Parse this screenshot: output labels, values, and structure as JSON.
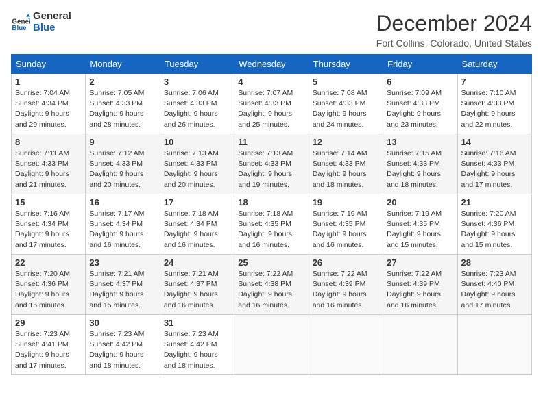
{
  "logo": {
    "line1": "General",
    "line2": "Blue"
  },
  "title": "December 2024",
  "location": "Fort Collins, Colorado, United States",
  "days_of_week": [
    "Sunday",
    "Monday",
    "Tuesday",
    "Wednesday",
    "Thursday",
    "Friday",
    "Saturday"
  ],
  "weeks": [
    [
      {
        "day": "1",
        "sunrise": "Sunrise: 7:04 AM",
        "sunset": "Sunset: 4:34 PM",
        "daylight": "Daylight: 9 hours and 29 minutes."
      },
      {
        "day": "2",
        "sunrise": "Sunrise: 7:05 AM",
        "sunset": "Sunset: 4:33 PM",
        "daylight": "Daylight: 9 hours and 28 minutes."
      },
      {
        "day": "3",
        "sunrise": "Sunrise: 7:06 AM",
        "sunset": "Sunset: 4:33 PM",
        "daylight": "Daylight: 9 hours and 26 minutes."
      },
      {
        "day": "4",
        "sunrise": "Sunrise: 7:07 AM",
        "sunset": "Sunset: 4:33 PM",
        "daylight": "Daylight: 9 hours and 25 minutes."
      },
      {
        "day": "5",
        "sunrise": "Sunrise: 7:08 AM",
        "sunset": "Sunset: 4:33 PM",
        "daylight": "Daylight: 9 hours and 24 minutes."
      },
      {
        "day": "6",
        "sunrise": "Sunrise: 7:09 AM",
        "sunset": "Sunset: 4:33 PM",
        "daylight": "Daylight: 9 hours and 23 minutes."
      },
      {
        "day": "7",
        "sunrise": "Sunrise: 7:10 AM",
        "sunset": "Sunset: 4:33 PM",
        "daylight": "Daylight: 9 hours and 22 minutes."
      }
    ],
    [
      {
        "day": "8",
        "sunrise": "Sunrise: 7:11 AM",
        "sunset": "Sunset: 4:33 PM",
        "daylight": "Daylight: 9 hours and 21 minutes."
      },
      {
        "day": "9",
        "sunrise": "Sunrise: 7:12 AM",
        "sunset": "Sunset: 4:33 PM",
        "daylight": "Daylight: 9 hours and 20 minutes."
      },
      {
        "day": "10",
        "sunrise": "Sunrise: 7:13 AM",
        "sunset": "Sunset: 4:33 PM",
        "daylight": "Daylight: 9 hours and 20 minutes."
      },
      {
        "day": "11",
        "sunrise": "Sunrise: 7:13 AM",
        "sunset": "Sunset: 4:33 PM",
        "daylight": "Daylight: 9 hours and 19 minutes."
      },
      {
        "day": "12",
        "sunrise": "Sunrise: 7:14 AM",
        "sunset": "Sunset: 4:33 PM",
        "daylight": "Daylight: 9 hours and 18 minutes."
      },
      {
        "day": "13",
        "sunrise": "Sunrise: 7:15 AM",
        "sunset": "Sunset: 4:33 PM",
        "daylight": "Daylight: 9 hours and 18 minutes."
      },
      {
        "day": "14",
        "sunrise": "Sunrise: 7:16 AM",
        "sunset": "Sunset: 4:33 PM",
        "daylight": "Daylight: 9 hours and 17 minutes."
      }
    ],
    [
      {
        "day": "15",
        "sunrise": "Sunrise: 7:16 AM",
        "sunset": "Sunset: 4:34 PM",
        "daylight": "Daylight: 9 hours and 17 minutes."
      },
      {
        "day": "16",
        "sunrise": "Sunrise: 7:17 AM",
        "sunset": "Sunset: 4:34 PM",
        "daylight": "Daylight: 9 hours and 16 minutes."
      },
      {
        "day": "17",
        "sunrise": "Sunrise: 7:18 AM",
        "sunset": "Sunset: 4:34 PM",
        "daylight": "Daylight: 9 hours and 16 minutes."
      },
      {
        "day": "18",
        "sunrise": "Sunrise: 7:18 AM",
        "sunset": "Sunset: 4:35 PM",
        "daylight": "Daylight: 9 hours and 16 minutes."
      },
      {
        "day": "19",
        "sunrise": "Sunrise: 7:19 AM",
        "sunset": "Sunset: 4:35 PM",
        "daylight": "Daylight: 9 hours and 16 minutes."
      },
      {
        "day": "20",
        "sunrise": "Sunrise: 7:19 AM",
        "sunset": "Sunset: 4:35 PM",
        "daylight": "Daylight: 9 hours and 15 minutes."
      },
      {
        "day": "21",
        "sunrise": "Sunrise: 7:20 AM",
        "sunset": "Sunset: 4:36 PM",
        "daylight": "Daylight: 9 hours and 15 minutes."
      }
    ],
    [
      {
        "day": "22",
        "sunrise": "Sunrise: 7:20 AM",
        "sunset": "Sunset: 4:36 PM",
        "daylight": "Daylight: 9 hours and 15 minutes."
      },
      {
        "day": "23",
        "sunrise": "Sunrise: 7:21 AM",
        "sunset": "Sunset: 4:37 PM",
        "daylight": "Daylight: 9 hours and 15 minutes."
      },
      {
        "day": "24",
        "sunrise": "Sunrise: 7:21 AM",
        "sunset": "Sunset: 4:37 PM",
        "daylight": "Daylight: 9 hours and 16 minutes."
      },
      {
        "day": "25",
        "sunrise": "Sunrise: 7:22 AM",
        "sunset": "Sunset: 4:38 PM",
        "daylight": "Daylight: 9 hours and 16 minutes."
      },
      {
        "day": "26",
        "sunrise": "Sunrise: 7:22 AM",
        "sunset": "Sunset: 4:39 PM",
        "daylight": "Daylight: 9 hours and 16 minutes."
      },
      {
        "day": "27",
        "sunrise": "Sunrise: 7:22 AM",
        "sunset": "Sunset: 4:39 PM",
        "daylight": "Daylight: 9 hours and 16 minutes."
      },
      {
        "day": "28",
        "sunrise": "Sunrise: 7:23 AM",
        "sunset": "Sunset: 4:40 PM",
        "daylight": "Daylight: 9 hours and 17 minutes."
      }
    ],
    [
      {
        "day": "29",
        "sunrise": "Sunrise: 7:23 AM",
        "sunset": "Sunset: 4:41 PM",
        "daylight": "Daylight: 9 hours and 17 minutes."
      },
      {
        "day": "30",
        "sunrise": "Sunrise: 7:23 AM",
        "sunset": "Sunset: 4:42 PM",
        "daylight": "Daylight: 9 hours and 18 minutes."
      },
      {
        "day": "31",
        "sunrise": "Sunrise: 7:23 AM",
        "sunset": "Sunset: 4:42 PM",
        "daylight": "Daylight: 9 hours and 18 minutes."
      },
      null,
      null,
      null,
      null
    ]
  ]
}
